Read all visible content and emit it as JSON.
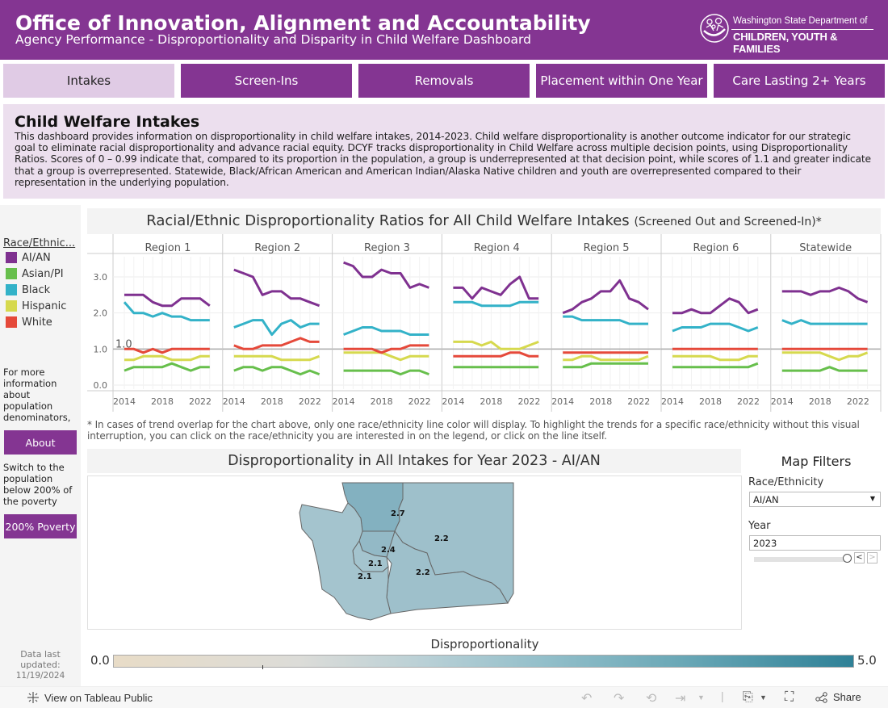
{
  "header": {
    "title": "Office of Innovation, Alignment and Accountability",
    "subtitle": "Agency Performance - Disproportionality and Disparity in Child Welfare Dashboard",
    "logo_line1": "Washington State Department of",
    "logo_line2": "CHILDREN, YOUTH & FAMILIES"
  },
  "tabs": [
    {
      "label": "Intakes",
      "active": true
    },
    {
      "label": "Screen-Ins",
      "active": false
    },
    {
      "label": "Removals",
      "active": false
    },
    {
      "label": "Placement within One Year",
      "active": false
    },
    {
      "label": "Care Lasting 2+ Years",
      "active": false
    }
  ],
  "intro": {
    "heading": "Child Welfare Intakes",
    "body": "This dashboard provides information on disproportionality in child welfare intakes, 2014-2023. Child welfare disproportionality is another outcome indicator for our strategic goal to eliminate racial disproportionality and advance racial equity. DCYF tracks disproportionality in Child Welfare across multiple decision points, using Disproportionality Ratios. Scores of 0 – 0.99 indicate that, compared to its proportion in the population, a group is underrepresented at that decision point, while scores of 1.1 and greater indicate that a group is overrepresented. Statewide, Black/African American and American Indian/Alaska Native children and youth are overrepresented compared to their representation in the underlying population."
  },
  "sidebar": {
    "legend_title": "Race/Ethnic...",
    "legend": [
      {
        "label": "AI/AN",
        "color": "#7f3190"
      },
      {
        "label": "Asian/PI",
        "color": "#67bf4c"
      },
      {
        "label": "Black",
        "color": "#33b2c8"
      },
      {
        "label": "Hispanic",
        "color": "#d6d94e"
      },
      {
        "label": "White",
        "color": "#e5493a"
      }
    ],
    "about_note": "For more information about population denominators,",
    "about_button": "About",
    "poverty_note": "Switch to the population below 200% of the poverty",
    "poverty_button": "200% Poverty",
    "updated_label": "Data last updated:",
    "updated_date": "11/19/2024"
  },
  "chart_data": {
    "type": "line",
    "title": "Racial/Ethnic Disproportionality Ratios for All Child Welfare Intakes",
    "title_suffix": "(Screened Out and Screened-In)*",
    "x": [
      2014,
      2015,
      2016,
      2017,
      2018,
      2019,
      2020,
      2021,
      2022,
      2023
    ],
    "x_ticks": [
      "2014",
      "2018",
      "2022"
    ],
    "y_ticks": [
      "0.0",
      "1.0",
      "2.0",
      "3.0"
    ],
    "ylim": [
      0,
      3.6
    ],
    "reference_line": {
      "value": 1.0,
      "label": "1.0"
    },
    "grid": true,
    "panels": [
      {
        "name": "Region 1",
        "series": {
          "AI/AN": [
            2.5,
            2.5,
            2.5,
            2.3,
            2.2,
            2.2,
            2.4,
            2.4,
            2.4,
            2.2
          ],
          "Black": [
            2.3,
            2.0,
            2.0,
            1.9,
            2.0,
            1.9,
            1.9,
            1.8,
            1.8,
            1.8
          ],
          "White": [
            1.0,
            1.0,
            0.9,
            1.0,
            0.9,
            1.0,
            1.0,
            1.0,
            1.0,
            1.0
          ],
          "Hispanic": [
            0.7,
            0.7,
            0.8,
            0.8,
            0.8,
            0.7,
            0.7,
            0.7,
            0.8,
            0.8
          ],
          "Asian/PI": [
            0.4,
            0.5,
            0.5,
            0.5,
            0.5,
            0.6,
            0.5,
            0.4,
            0.5,
            0.5
          ]
        }
      },
      {
        "name": "Region 2",
        "series": {
          "AI/AN": [
            3.2,
            3.1,
            3.0,
            2.5,
            2.6,
            2.6,
            2.4,
            2.4,
            2.3,
            2.2
          ],
          "Black": [
            1.6,
            1.7,
            1.8,
            1.8,
            1.4,
            1.7,
            1.8,
            1.6,
            1.7,
            1.7
          ],
          "White": [
            1.1,
            1.0,
            1.0,
            1.1,
            1.1,
            1.1,
            1.2,
            1.3,
            1.2,
            1.2
          ],
          "Hispanic": [
            0.8,
            0.8,
            0.8,
            0.8,
            0.8,
            0.7,
            0.7,
            0.7,
            0.7,
            0.8
          ],
          "Asian/PI": [
            0.4,
            0.5,
            0.5,
            0.4,
            0.5,
            0.5,
            0.4,
            0.3,
            0.4,
            0.3
          ]
        }
      },
      {
        "name": "Region 3",
        "series": {
          "AI/AN": [
            3.4,
            3.3,
            3.0,
            3.0,
            3.2,
            3.1,
            3.1,
            2.7,
            2.8,
            2.7
          ],
          "Black": [
            1.4,
            1.5,
            1.6,
            1.6,
            1.5,
            1.5,
            1.5,
            1.4,
            1.4,
            1.4
          ],
          "White": [
            1.0,
            1.0,
            1.0,
            1.0,
            0.9,
            1.0,
            1.0,
            1.1,
            1.1,
            1.1
          ],
          "Hispanic": [
            0.9,
            0.9,
            0.9,
            0.9,
            0.9,
            0.8,
            0.7,
            0.8,
            0.8,
            0.8
          ],
          "Asian/PI": [
            0.4,
            0.4,
            0.4,
            0.4,
            0.4,
            0.4,
            0.3,
            0.4,
            0.4,
            0.3
          ]
        }
      },
      {
        "name": "Region 4",
        "series": {
          "AI/AN": [
            2.7,
            2.7,
            2.4,
            2.7,
            2.6,
            2.5,
            2.8,
            3.0,
            2.4,
            2.4
          ],
          "Black": [
            2.3,
            2.3,
            2.3,
            2.2,
            2.2,
            2.2,
            2.2,
            2.3,
            2.3,
            2.3
          ],
          "Hispanic": [
            1.2,
            1.2,
            1.2,
            1.1,
            1.2,
            1.0,
            1.0,
            1.0,
            1.1,
            1.2
          ],
          "White": [
            0.8,
            0.8,
            0.8,
            0.8,
            0.8,
            0.8,
            0.9,
            0.9,
            0.8,
            0.8
          ],
          "Asian/PI": [
            0.5,
            0.5,
            0.5,
            0.5,
            0.5,
            0.5,
            0.5,
            0.5,
            0.5,
            0.5
          ]
        }
      },
      {
        "name": "Region 5",
        "series": {
          "AI/AN": [
            2.0,
            2.1,
            2.3,
            2.4,
            2.6,
            2.6,
            2.9,
            2.4,
            2.3,
            2.1
          ],
          "Black": [
            1.9,
            1.9,
            1.8,
            1.8,
            1.8,
            1.8,
            1.8,
            1.7,
            1.7,
            1.7
          ],
          "White": [
            0.9,
            0.9,
            0.9,
            0.9,
            0.9,
            0.9,
            0.9,
            0.9,
            0.9,
            0.9
          ],
          "Hispanic": [
            0.7,
            0.7,
            0.8,
            0.8,
            0.7,
            0.7,
            0.7,
            0.7,
            0.7,
            0.8
          ],
          "Asian/PI": [
            0.5,
            0.5,
            0.5,
            0.6,
            0.6,
            0.6,
            0.6,
            0.6,
            0.6,
            0.6
          ]
        }
      },
      {
        "name": "Region 6",
        "series": {
          "AI/AN": [
            2.0,
            2.0,
            2.1,
            2.0,
            2.0,
            2.2,
            2.4,
            2.3,
            2.0,
            2.1
          ],
          "Black": [
            1.5,
            1.6,
            1.6,
            1.6,
            1.7,
            1.7,
            1.7,
            1.6,
            1.5,
            1.6
          ],
          "White": [
            1.0,
            1.0,
            1.0,
            1.0,
            1.0,
            1.0,
            1.0,
            1.0,
            1.0,
            1.0
          ],
          "Hispanic": [
            0.8,
            0.8,
            0.8,
            0.8,
            0.8,
            0.7,
            0.7,
            0.7,
            0.8,
            0.8
          ],
          "Asian/PI": [
            0.5,
            0.5,
            0.5,
            0.5,
            0.5,
            0.5,
            0.5,
            0.5,
            0.5,
            0.6
          ]
        }
      },
      {
        "name": "Statewide",
        "series": {
          "AI/AN": [
            2.6,
            2.6,
            2.6,
            2.5,
            2.6,
            2.6,
            2.7,
            2.6,
            2.4,
            2.3
          ],
          "Black": [
            1.8,
            1.7,
            1.8,
            1.7,
            1.7,
            1.7,
            1.7,
            1.7,
            1.7,
            1.7
          ],
          "White": [
            1.0,
            1.0,
            1.0,
            1.0,
            1.0,
            1.0,
            1.0,
            1.0,
            1.0,
            1.0
          ],
          "Hispanic": [
            0.9,
            0.9,
            0.9,
            0.9,
            0.9,
            0.8,
            0.7,
            0.8,
            0.8,
            0.9
          ],
          "Asian/PI": [
            0.4,
            0.4,
            0.4,
            0.4,
            0.4,
            0.5,
            0.4,
            0.4,
            0.4,
            0.4
          ]
        }
      }
    ]
  },
  "footnote": "* In cases of trend overlap for the chart above, only one race/ethnicity line color will display. To highlight the trends for a specific race/ethnicity without this visual interruption, you can click on the race/ethnicity you are interested in on the legend, or click on the line itself.",
  "map": {
    "title": "Disproportionality in All Intakes for Year 2023 - AI/AN",
    "regions": [
      {
        "name": "Region 1",
        "value": "2.2"
      },
      {
        "name": "Region 2",
        "value": "2.7"
      },
      {
        "name": "Region 3",
        "value": "2.2"
      },
      {
        "name": "Region 4",
        "value": "2.4"
      },
      {
        "name": "Region 5",
        "value": "2.1"
      },
      {
        "name": "Region 6",
        "value": "2.1"
      }
    ],
    "color_legend_title": "Disproportionality",
    "color_min": "0.0",
    "color_max": "5.0"
  },
  "filters": {
    "title": "Map Filters",
    "race_label": "Race/Ethnicity",
    "race_value": "AI/AN",
    "year_label": "Year",
    "year_value": "2023",
    "year_slider_fraction": 1.0
  },
  "toolbar": {
    "tableau_label": "View on Tableau Public",
    "share_label": "Share"
  }
}
